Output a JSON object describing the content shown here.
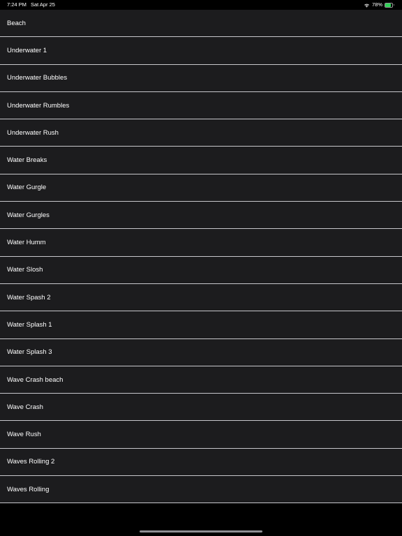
{
  "status_bar": {
    "time": "7:24 PM",
    "date": "Sat Apr 25",
    "battery_percent_text": "78%",
    "battery_level": 0.78,
    "battery_color": "#30d158"
  },
  "icons": {
    "wifi": "wifi-icon",
    "battery": "battery-icon"
  },
  "sounds": [
    "Beach",
    "Underwater 1",
    "Underwater Bubbles",
    "Underwater Rumbles",
    "Underwater Rush",
    "Water Breaks",
    "Water Gurgle",
    "Water Gurgles",
    "Water Humm",
    "Water Slosh",
    "Water Spash 2",
    "Water Splash 1",
    "Water Splash 3",
    "Wave Crash beach",
    "Wave Crash",
    "Wave Rush",
    "Waves Rolling 2",
    "Waves Rolling"
  ]
}
